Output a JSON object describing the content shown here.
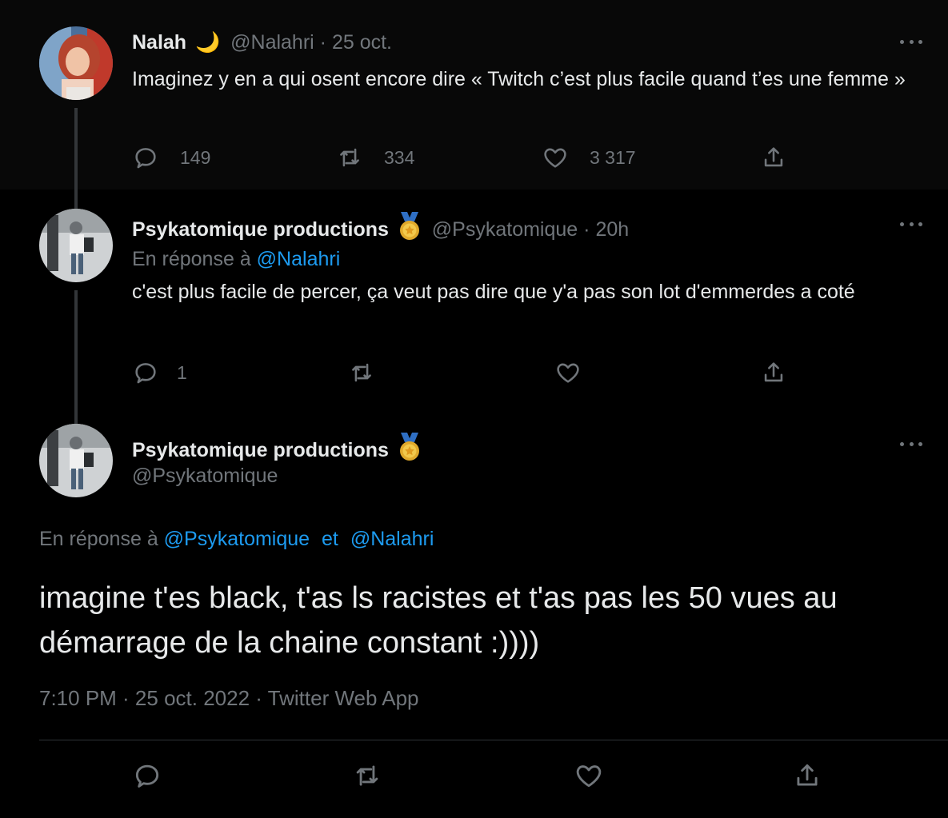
{
  "tweets": [
    {
      "name": "Nalah",
      "name_emoji": "🌙",
      "handle": "@Nalahri",
      "separator": "·",
      "time": "25 oct.",
      "text": "Imaginez y en a qui osent encore dire « Twitch c’est plus facile quand t’es une femme »",
      "actions": {
        "replies": "149",
        "retweets": "334",
        "likes": "3 317"
      }
    },
    {
      "name": "Psykatomique productions",
      "handle": "@Psykatomique",
      "separator": "·",
      "time": "20h",
      "reply_prefix": "En réponse à",
      "reply_to": "@Nalahri",
      "text": "c'est plus facile de percer, ça veut pas dire que y'a pas son lot d'emmerdes a coté",
      "actions": {
        "replies": "1",
        "retweets": "",
        "likes": ""
      }
    },
    {
      "name": "Psykatomique productions",
      "handle": "@Psykatomique",
      "reply_prefix": "En réponse à",
      "reply_to_1": "@Psykatomique",
      "reply_and": "et",
      "reply_to_2": "@Nalahri",
      "text": "imagine t'es black, t'as ls racistes et t'as pas les 50 vues au démarrage de la chaine constant :))))",
      "meta": "7:10 PM · 25 oct. 2022 · Twitter Web App"
    }
  ],
  "colors": {
    "background": "#000000",
    "text": "#e7e9ea",
    "muted": "#71767b",
    "link": "#1d9bf0"
  },
  "icons": [
    "reply-icon",
    "retweet-icon",
    "like-icon",
    "share-icon",
    "more-icon",
    "medal-icon",
    "moon-emoji"
  ]
}
